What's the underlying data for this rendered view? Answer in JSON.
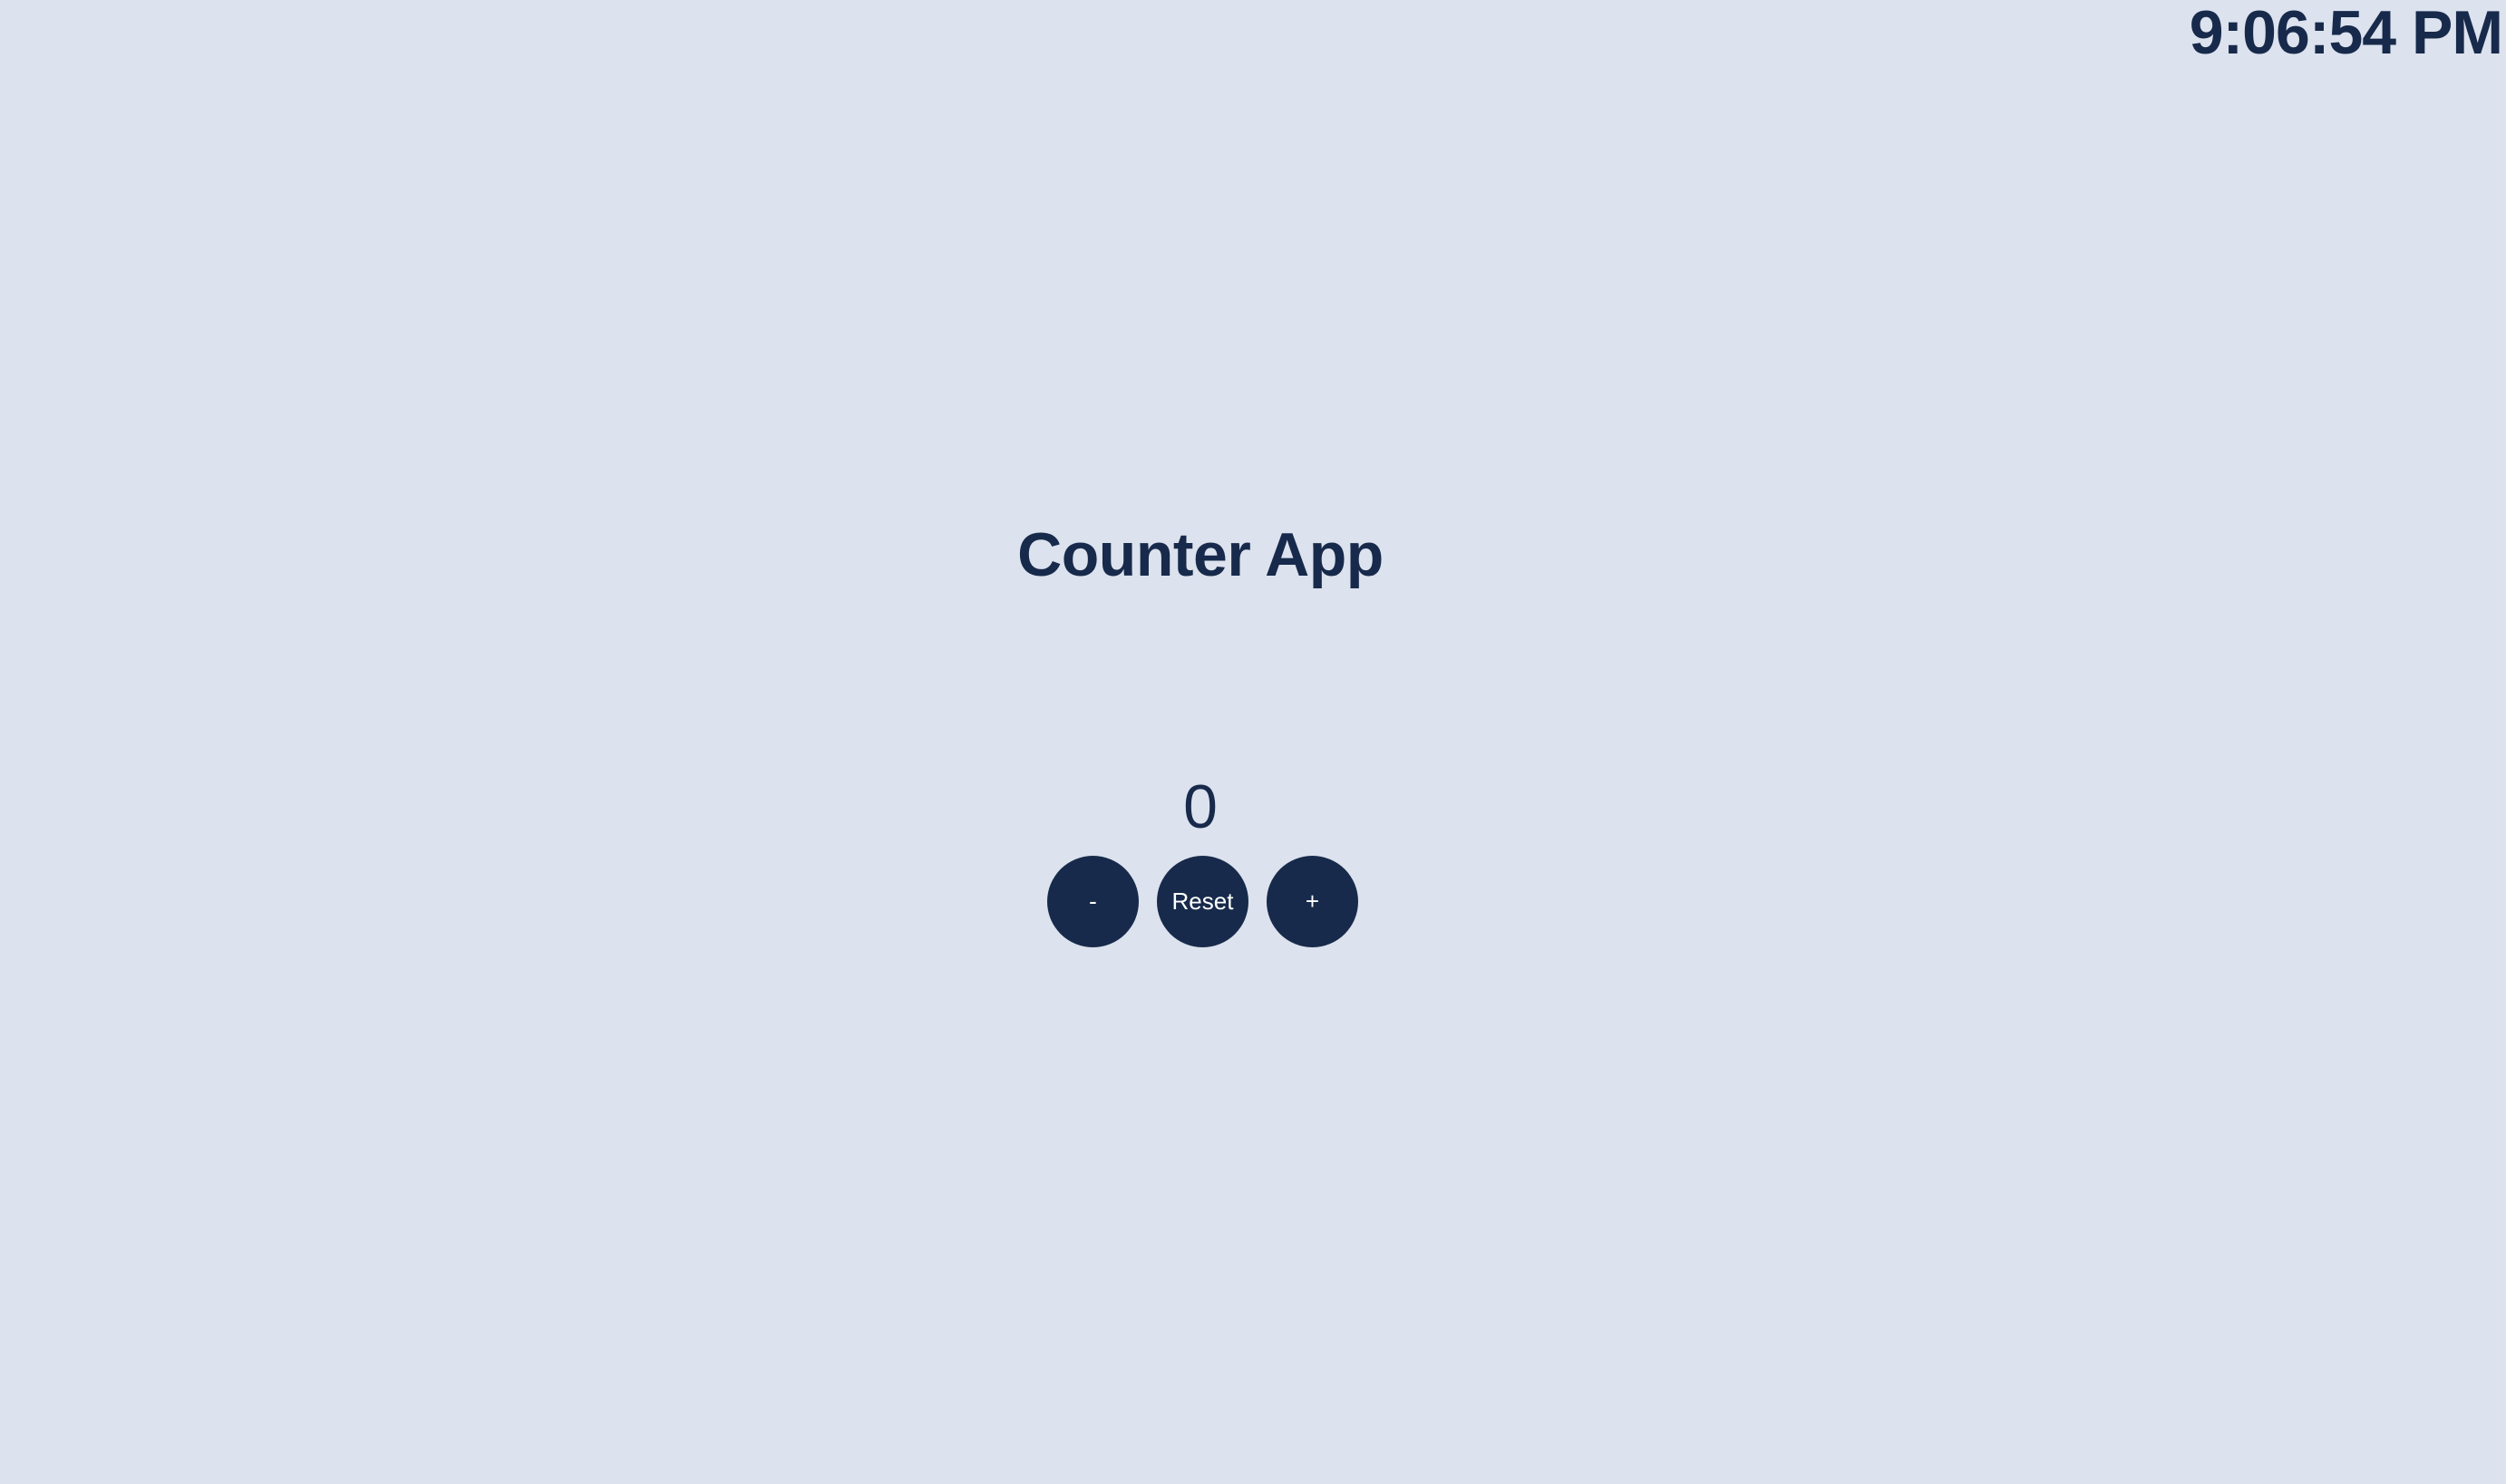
{
  "clock": {
    "time": "9:06:54 PM"
  },
  "app": {
    "title": "Counter App",
    "count": "0"
  },
  "controls": {
    "decrement_label": "-",
    "reset_label": "Reset",
    "increment_label": "+"
  },
  "colors": {
    "background": "#dce2ee",
    "primary": "#172a4b",
    "button_text": "#ffffff"
  }
}
